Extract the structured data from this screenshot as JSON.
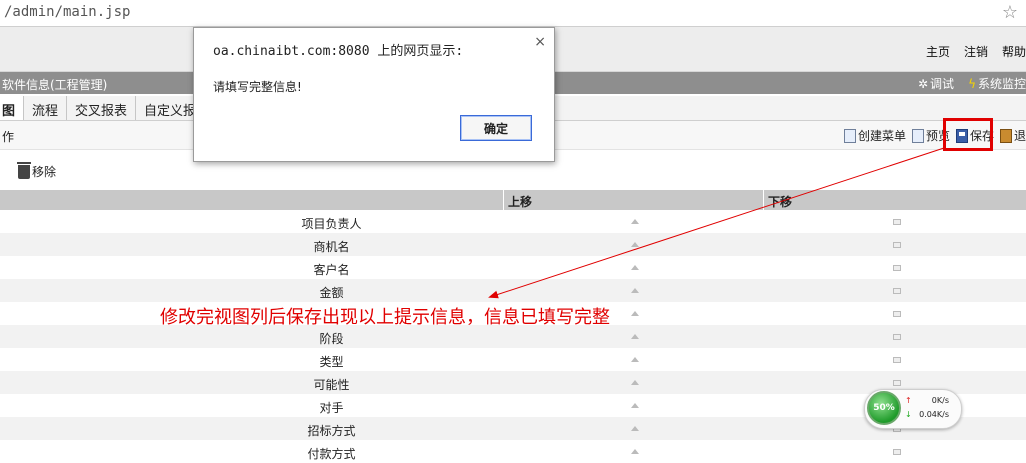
{
  "browser": {
    "url": "/admin/main.jsp"
  },
  "topnav": {
    "home": "主页",
    "logout": "注销",
    "help": "帮助"
  },
  "titlebar": {
    "title": "软件信息(工程管理)",
    "debug": "调试",
    "monitor": "系统监控"
  },
  "tabs": [
    {
      "label": "图",
      "active": true
    },
    {
      "label": "流程"
    },
    {
      "label": "交叉报表"
    },
    {
      "label": "自定义报"
    }
  ],
  "actionbar": {
    "label": "作",
    "create_menu": "创建菜单",
    "preview": "预览",
    "save": "保存",
    "exit": "退"
  },
  "remove_label": "移除",
  "grid": {
    "headers": [
      "",
      "上移",
      "下移"
    ],
    "rows": [
      "项目负责人",
      "商机名",
      "客户名",
      "金额",
      "",
      "阶段",
      "类型",
      "可能性",
      "对手",
      "招标方式",
      "付款方式"
    ]
  },
  "annotation": "修改完视图列后保存出现以上提示信息，信息已填写完整",
  "dialog": {
    "title": "oa.chinaibt.com:8080 上的网页显示:",
    "message": "请填写完整信息!",
    "ok": "确定",
    "close": "×"
  },
  "net_widget": {
    "percent": "50%",
    "up": "0K/s",
    "down": "0.04K/s"
  }
}
